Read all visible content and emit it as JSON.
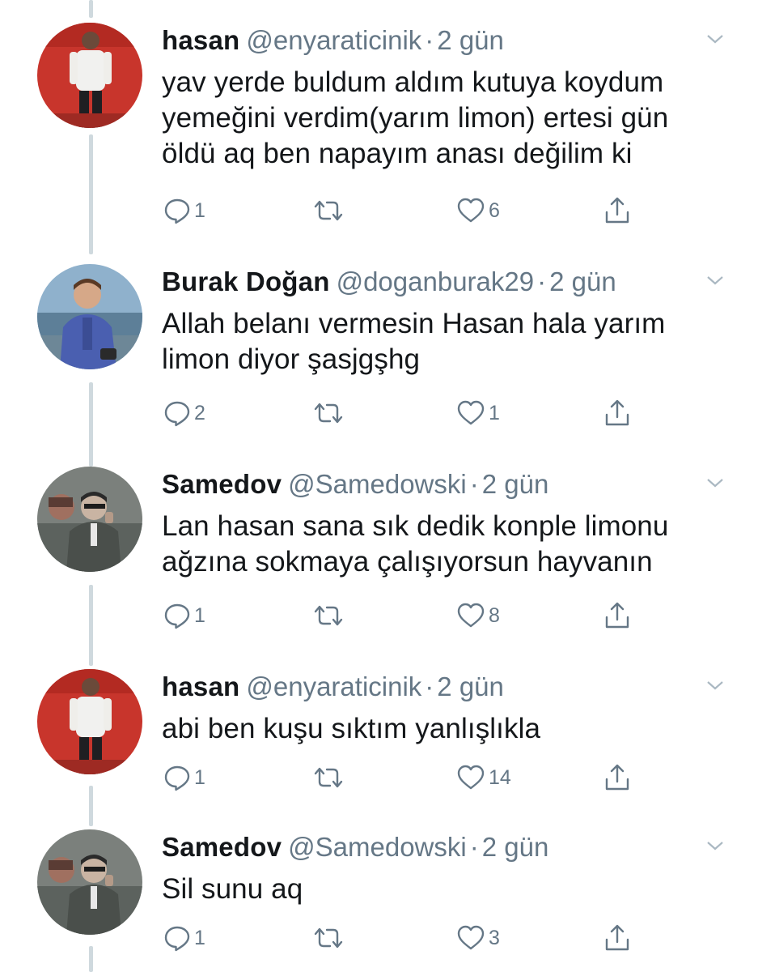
{
  "tweets": [
    {
      "name": "hasan",
      "handle": "@enyaraticinik",
      "separator": "·",
      "time": "2 gün",
      "text": [
        "yav yerde buldum aldım kutuya koydum",
        "yemeğini verdim(yarım limon) ertesi gün",
        "öldü aq ben napayım anası değilim ki"
      ],
      "replies": "1",
      "retweets": "",
      "likes": "6",
      "avatar": "hasan-avatar"
    },
    {
      "name": "Burak Doğan",
      "handle": "@doganburak29",
      "separator": "·",
      "time": "2 gün",
      "text": [
        "Allah belanı vermesin Hasan hala yarım",
        "limon diyor şasjgşhg"
      ],
      "replies": "2",
      "retweets": "",
      "likes": "1",
      "avatar": "burak-avatar"
    },
    {
      "name": "Samedov",
      "handle": "@Samedowski",
      "separator": "·",
      "time": "2 gün",
      "text": [
        "Lan hasan sana sık dedik konple limonu",
        "ağzına sokmaya çalışıyorsun hayvanın"
      ],
      "replies": "1",
      "retweets": "",
      "likes": "8",
      "avatar": "samedov-avatar"
    },
    {
      "name": "hasan",
      "handle": "@enyaraticinik",
      "separator": "·",
      "time": "2 gün",
      "text": [
        "abi ben kuşu sıktım yanlışlıkla"
      ],
      "replies": "1",
      "retweets": "",
      "likes": "14",
      "avatar": "hasan-avatar"
    },
    {
      "name": "Samedov",
      "handle": "@Samedowski",
      "separator": "·",
      "time": "2 gün",
      "text": [
        "Sil sunu aq"
      ],
      "replies": "1",
      "retweets": "",
      "likes": "3",
      "avatar": "samedov-avatar"
    }
  ],
  "icons": {
    "reply": "reply-icon",
    "retweet": "retweet-icon",
    "like": "heart-icon",
    "share": "share-icon",
    "menu": "chevron-down-icon"
  },
  "colors": {
    "text": "#14171a",
    "secondary": "#657786",
    "thread_line": "#cfd9de",
    "background": "#ffffff"
  }
}
